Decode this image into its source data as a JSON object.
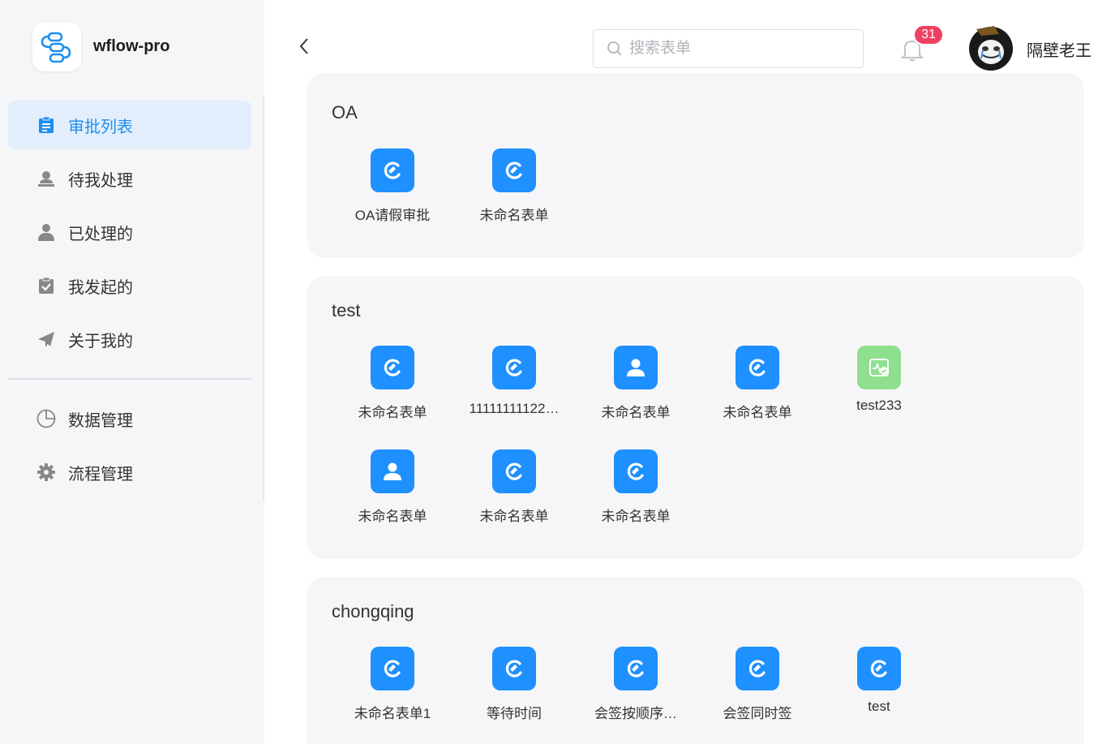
{
  "app": {
    "name": "wflow-pro"
  },
  "sidebar": {
    "items": [
      {
        "label": "审批列表",
        "icon": "clipboard-list-icon",
        "active": true
      },
      {
        "label": "待我处理",
        "icon": "user-stamp-icon",
        "active": false
      },
      {
        "label": "已处理的",
        "icon": "user-icon",
        "active": false
      },
      {
        "label": "我发起的",
        "icon": "clipboard-check-icon",
        "active": false
      },
      {
        "label": "关于我的",
        "icon": "paper-plane-icon",
        "active": false
      }
    ],
    "admin_items": [
      {
        "label": "数据管理",
        "icon": "pie-chart-icon"
      },
      {
        "label": "流程管理",
        "icon": "gear-icon"
      }
    ]
  },
  "header": {
    "search_placeholder": "搜索表单",
    "notification_count": "31",
    "username": "隔壁老王"
  },
  "groups": [
    {
      "title": "OA",
      "items": [
        {
          "label": "OA请假审批",
          "icon": "form-edit-icon",
          "color": "#1e90ff"
        },
        {
          "label": "未命名表单",
          "icon": "form-edit-icon",
          "color": "#1e90ff"
        }
      ]
    },
    {
      "title": "test",
      "items": [
        {
          "label": "未命名表单",
          "icon": "form-edit-icon",
          "color": "#1e90ff"
        },
        {
          "label": "11111111122…",
          "icon": "form-edit-icon",
          "color": "#1e90ff"
        },
        {
          "label": "未命名表单",
          "icon": "person-icon",
          "color": "#1e90ff"
        },
        {
          "label": "未命名表单",
          "icon": "form-edit-icon",
          "color": "#1e90ff"
        },
        {
          "label": "test233",
          "icon": "health-check-icon",
          "color": "#8ee08e"
        },
        {
          "label": "未命名表单",
          "icon": "person-icon",
          "color": "#1e90ff"
        },
        {
          "label": "未命名表单",
          "icon": "form-edit-icon",
          "color": "#1e90ff"
        },
        {
          "label": "未命名表单",
          "icon": "form-edit-icon",
          "color": "#1e90ff"
        }
      ]
    },
    {
      "title": "chongqing",
      "items": [
        {
          "label": "未命名表单1",
          "icon": "form-edit-icon",
          "color": "#1e90ff"
        },
        {
          "label": "等待时间",
          "icon": "form-edit-icon",
          "color": "#1e90ff"
        },
        {
          "label": "会签按顺序…",
          "icon": "form-edit-icon",
          "color": "#1e90ff"
        },
        {
          "label": "会签同时签",
          "icon": "form-edit-icon",
          "color": "#1e90ff"
        },
        {
          "label": "test",
          "icon": "form-edit-icon",
          "color": "#1e90ff"
        }
      ]
    }
  ],
  "colors": {
    "accent": "#1f8ff0",
    "badge": "#ee4060",
    "active_bg": "#e3eefc"
  }
}
